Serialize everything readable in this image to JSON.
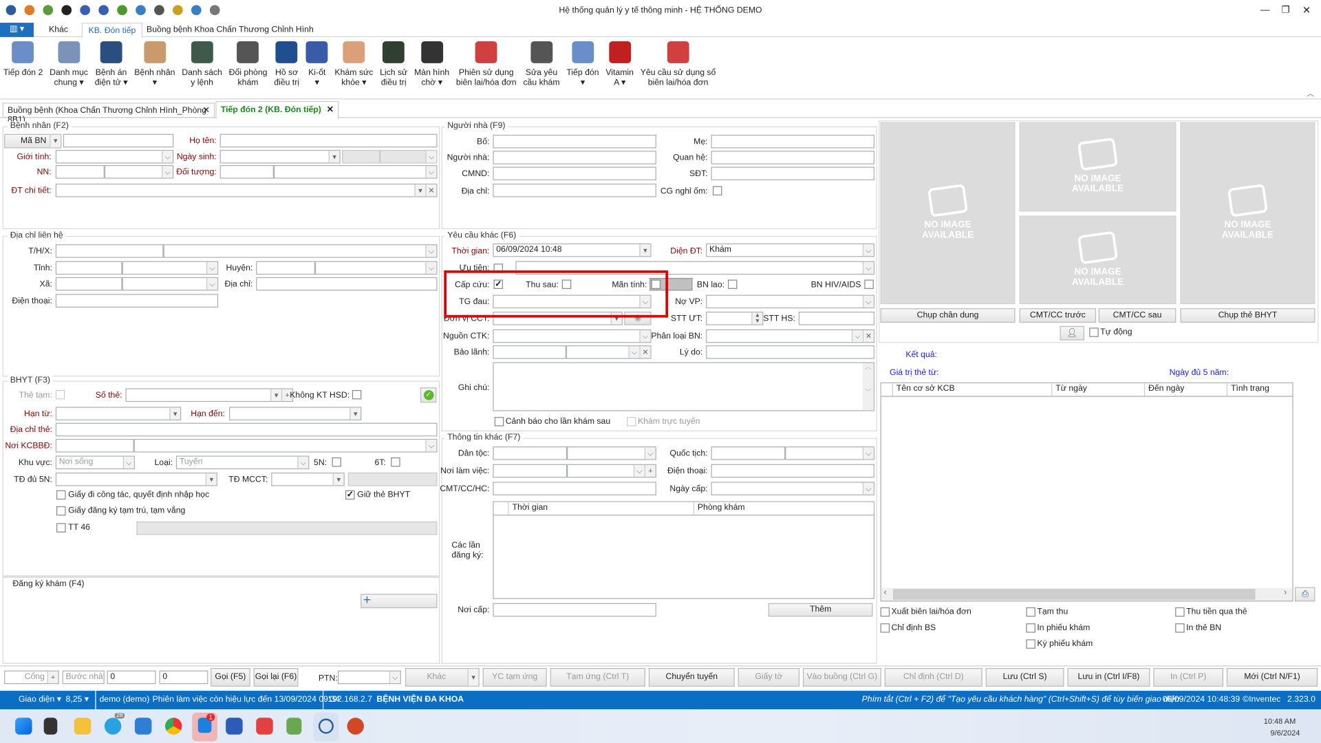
{
  "window": {
    "title": "Hệ thống quản lý y tế thông minh - HỆ THỐNG DEMO",
    "minimize": "—",
    "restore": "❐",
    "close": "✕"
  },
  "quick_access": [
    "app-logo-icon",
    "chart-icon",
    "home-icon",
    "phone-icon",
    "help-icon",
    "undo-icon",
    "refresh-icon",
    "sync-icon",
    "search-doc-icon",
    "lock-icon",
    "power-icon",
    "headset-icon"
  ],
  "ribbon_tabs": {
    "menu": "▥ ▾",
    "items": [
      "Khác",
      "KB. Đón tiếp",
      "Buồng bệnh Khoa Chấn Thương Chỉnh Hình"
    ]
  },
  "ribbon": [
    {
      "label": "Tiếp đón 2",
      "color": "#6a8fc8"
    },
    {
      "label": "Danh mục\nchung ▾",
      "color": "#7d92b8"
    },
    {
      "label": "Bệnh án\nđiện tử ▾",
      "color": "#2b4e80"
    },
    {
      "label": "Bệnh nhân\n▾",
      "color": "#c99a6b"
    },
    {
      "label": "Danh sách\ny lệnh",
      "color": "#3f5a4a"
    },
    {
      "label": "Đổi phòng\nkhám",
      "color": "#555"
    },
    {
      "label": "Hồ sơ\nđiều trị",
      "color": "#1f4f8f"
    },
    {
      "label": "Ki-ốt\n▾",
      "color": "#3a5ca8"
    },
    {
      "label": "Khám sức\nkhỏe ▾",
      "color": "#d9a07a"
    },
    {
      "label": "Lịch sử\nđiều trị",
      "color": "#2f4030"
    },
    {
      "label": "Màn hình\nchờ ▾",
      "color": "#333"
    },
    {
      "label": "Phiên sử dụng\nbiên lai/hóa đơn",
      "color": "#d04040"
    },
    {
      "label": "Sửa yêu\ncầu khám",
      "color": "#555"
    },
    {
      "label": "Tiếp đón\n▾",
      "color": "#6a8fc8"
    },
    {
      "label": "Vitamin\nA ▾",
      "color": "#c02020"
    },
    {
      "label": "Yêu cầu sử dụng sổ\nbiên lai/hóa đơn",
      "color": "#d04040"
    }
  ],
  "doc_tabs": [
    {
      "label": "Buồng bệnh (Khoa Chấn Thương Chỉnh Hình_Phòng 8B1)",
      "close": "✕"
    },
    {
      "label": "Tiếp đón 2 (KB. Đón tiếp)",
      "close": "✕"
    }
  ],
  "patient": {
    "legend": "Bệnh nhân (F2)",
    "ma_bn": "Mã BN",
    "ho_ten": "Họ tên:",
    "gioi_tinh": "Giới tính:",
    "ngay_sinh": "Ngày sinh:",
    "nn": "NN:",
    "doi_tuong": "Đối tượng:",
    "dt_chi_tiet": "ĐT chi tiết:"
  },
  "address": {
    "legend": "Địa chỉ liên hệ",
    "thx": "T/H/X:",
    "tinh": "Tỉnh:",
    "huyen": "Huyện:",
    "xa": "Xã:",
    "dia_chi": "Địa chỉ:",
    "dien_thoai": "Điện thoại:"
  },
  "bhyt": {
    "legend": "BHYT (F3)",
    "the_tam": "Thẻ tạm:",
    "so_the": "Số thẻ:",
    "khong_kt_hsd": "Không KT HSD:",
    "han_tu": "Hạn từ:",
    "han_den": "Hạn đến:",
    "dia_chi_the": "Địa chỉ thẻ:",
    "noi_kcbbd": "Nơi KCBBĐ:",
    "khu_vuc": "Khu vực:",
    "khu_vuc_value": "Nơi sống",
    "loai": "Loại:",
    "loai_value": "Tuyến",
    "n5": "5N:",
    "t6": "6T:",
    "td_du_5n": "TĐ đủ 5N:",
    "td_mcct": "TĐ MCCT:",
    "giay_cong_tac": "Giấy đi công tác, quyết định nhập học",
    "giu_the": "Giữ thẻ BHYT",
    "giu_the_checked": true,
    "giay_tam_tru": "Giấy đăng ký tạm trú, tạm vắng",
    "tt46": "TT 46"
  },
  "register": {
    "legend": "Đăng ký khám (F4)",
    "add": "+"
  },
  "relative": {
    "legend": "Người nhà (F9)",
    "bo": "Bố:",
    "me": "Mẹ:",
    "nguoi_nha": "Người nhà:",
    "quan_he": "Quan hệ:",
    "cmnd": "CMND:",
    "sdt": "SĐT:",
    "dia_chi": "Địa chỉ:",
    "cg_nghi_om": "CG nghỉ ốm:"
  },
  "other_req": {
    "legend": "Yêu cầu khác (F6)",
    "thoi_gian": "Thời gian:",
    "thoi_gian_value": "06/09/2024 10:48",
    "dien_dt": "Diện ĐT:",
    "dien_dt_value": "Khám",
    "uu_tien": "Ưu tiên:",
    "cap_cuu": "Cấp cứu:",
    "cap_cuu_checked": true,
    "thu_sau": "Thu sau:",
    "man_tinh": "Mãn tính:",
    "bn_lao": "BN lao:",
    "bn_hiv": "BN HIV/AIDS",
    "tg_dau": "TG đau:",
    "no_vp": "Nợ VP:",
    "don_vi_cct": "Đơn vị CCT:",
    "stt_ut": "STT ƯT:",
    "stt_hs": "STT HS:",
    "nguon_ctk": "Nguồn CTK:",
    "phan_loai_bn": "Phân loại BN:",
    "bao_lanh": "Bảo lãnh:",
    "ly_do": "Lý do:",
    "ghi_chu": "Ghi chú:",
    "canh_bao": "Cảnh báo cho lần khám sau",
    "kham_truc_tuyen": "Khám trực tuyến",
    "highlight_color": "#e00000"
  },
  "other_info": {
    "legend": "Thông tin khác (F7)",
    "dan_toc": "Dân tộc:",
    "quoc_tich": "Quốc tịch:",
    "noi_lam_viec": "Nơi làm việc:",
    "dien_thoai": "Điện thoại:",
    "cmt": "CMT/CC/HC:",
    "ngay_cap": "Ngày cấp:",
    "cac_lan": "Các lần\nđăng ký:",
    "columns": [
      "Thời gian",
      "Phòng khám"
    ],
    "noi_cap": "Nơi cấp:",
    "them": "Thêm"
  },
  "photos": {
    "no_image": "NO IMAGE\nAVAILABLE",
    "chup_chan_dung": "Chụp chân dung",
    "cmt_truoc": "CMT/CC trước",
    "cmt_sau": "CMT/CC sau",
    "chup_the": "Chụp thẻ BHYT",
    "tu_dong": "Tự động"
  },
  "result": {
    "ket_qua": "Kết quả:",
    "gia_tri_the": "Giá trị thẻ từ:",
    "ngay_du_5": "Ngày đủ 5 năm:",
    "columns": [
      "Tên cơ sở KCB",
      "Từ ngày",
      "Đến ngày",
      "Tình trạng"
    ]
  },
  "options": {
    "xuat_bien_lai": "Xuất biên lai/hóa đơn",
    "chi_dinh_bs": "Chỉ định BS",
    "tam_thu": "Tạm thu",
    "in_phieu_kham": "In phiếu khám",
    "ky_phieu_kham": "Ký phiếu khám",
    "thu_tien_the": "Thu tiền qua thẻ",
    "in_the_bn": "In thẻ BN"
  },
  "bottom": {
    "cong": "Cổng",
    "buoc_nhay": "Bước nhảy",
    "v1": "0",
    "v2": "0",
    "goi": "Gọi (F5)",
    "goi_lai": "Gọi lại (F6)",
    "ptn": "PTN:",
    "khac": "Khác",
    "yc_tam_ung": "YC tạm ứng",
    "tam_ung": "Tạm ứng (Ctrl T)",
    "chuyen_tuyen": "Chuyển tuyến",
    "giay_to": "Giấy tờ",
    "vao_buong": "Vào buồng (Ctrl G)",
    "chi_dinh": "Chỉ định (Ctrl D)",
    "luu": "Lưu (Ctrl S)",
    "luu_in": "Lưu in (Ctrl I/F8)",
    "in": "In (Ctrl P)",
    "moi": "Mới (Ctrl N/F1)"
  },
  "status": {
    "giao_dien": "Giao diện ▾",
    "zoom": "8,25 ▾",
    "user": "demo (demo)",
    "session": "Phiên làm việc còn hiệu lực đến 13/09/2024 09:34",
    "ip": "192.168.2.7",
    "hospital": "BỆNH VIỆN ĐA KHOA",
    "hint": "Phím tắt (Ctrl + F2) để \"Tạo yêu cầu khách hàng\" (Ctrl+Shift+S) để tùy biến giao diện",
    "datetime": "06/09/2024 10:48:39",
    "brand": "©Inventec",
    "version": "2.323.0",
    "color": "#0b6ec5"
  },
  "taskbar": {
    "time": "10:48 AM",
    "date": "9/6/2024",
    "telegram_badge": "28",
    "zalo_badge": "1"
  }
}
